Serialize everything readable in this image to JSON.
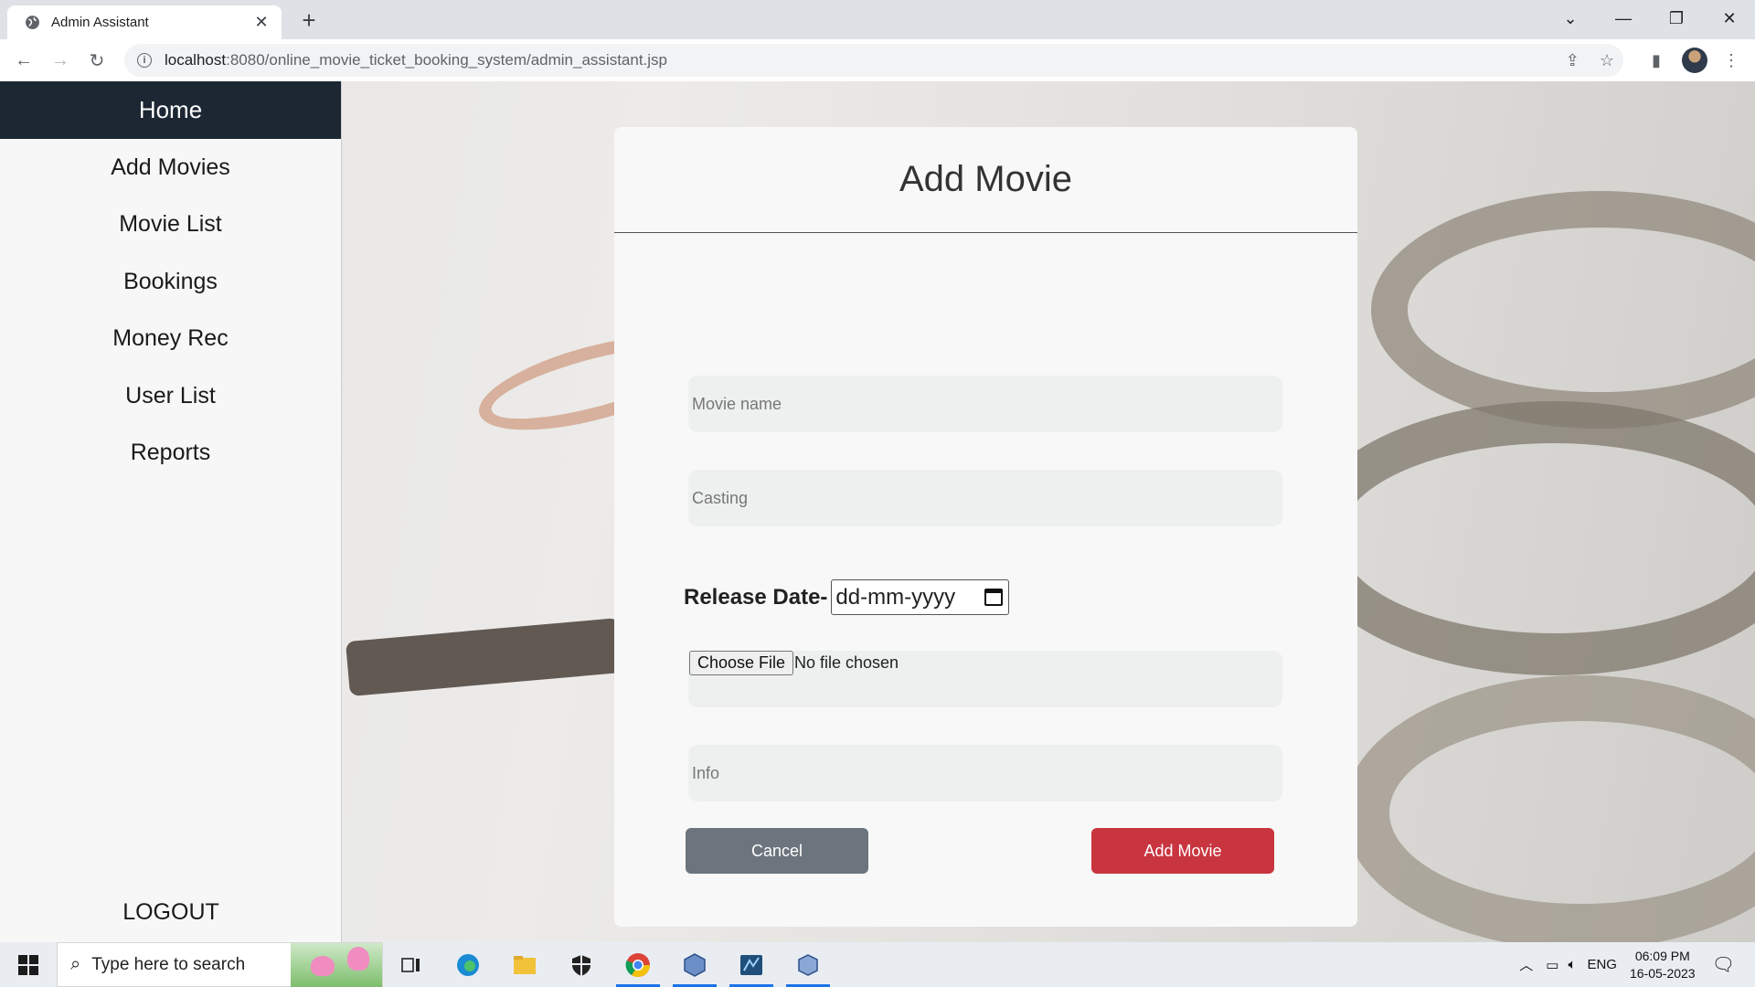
{
  "browser": {
    "tab_title": "Admin Assistant",
    "url_host": "localhost",
    "url_rest": ":8080/online_movie_ticket_booking_system/admin_assistant.jsp"
  },
  "sidebar": {
    "home": "Home",
    "items": [
      "Add Movies",
      "Movie List",
      "Bookings",
      "Money Rec",
      "User List",
      "Reports"
    ],
    "logout": "LOGOUT"
  },
  "form": {
    "title": "Add Movie",
    "movie_name_placeholder": "Movie name",
    "casting_placeholder": "Casting",
    "release_date_label": "Release Date-",
    "release_date_value": "dd-mm-yyyy",
    "choose_file_label": "Choose File",
    "no_file_text": "No file chosen",
    "info_placeholder": "Info",
    "cancel_label": "Cancel",
    "submit_label": "Add Movie"
  },
  "colors": {
    "sidebar_active": "#1c2733",
    "cancel": "#6c757d",
    "submit": "#c9353f"
  },
  "taskbar": {
    "search_placeholder": "Type here to search",
    "lang": "ENG",
    "time": "06:09 PM",
    "date": "16-05-2023"
  }
}
